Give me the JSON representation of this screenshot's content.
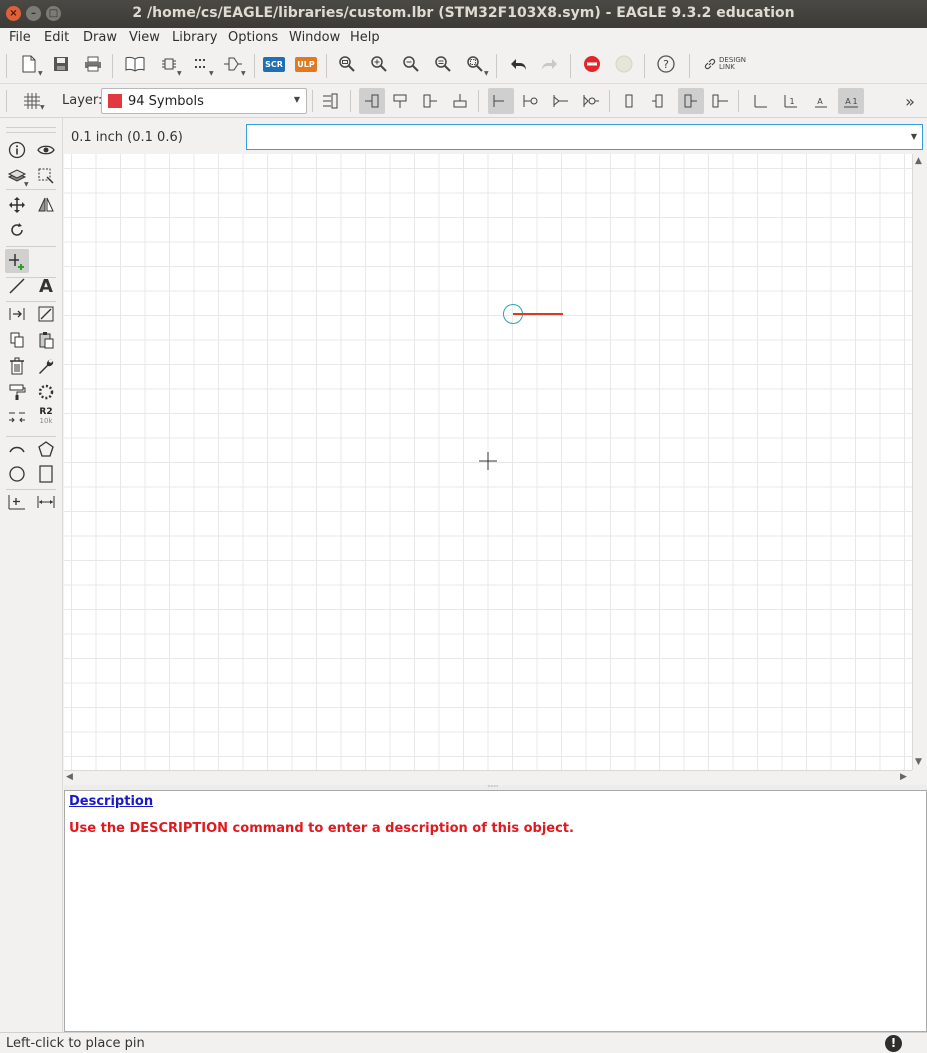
{
  "window": {
    "title": "2 /home/cs/EAGLE/libraries/custom.lbr (STM32F103X8.sym) - EAGLE 9.3.2 education",
    "close_glyph": "×",
    "min_glyph": "–",
    "max_glyph": "□"
  },
  "menu": [
    "File",
    "Edit",
    "Draw",
    "View",
    "Library",
    "Options",
    "Window",
    "Help"
  ],
  "toolbar": {
    "scr_label": "SCR",
    "ulp_label": "ULP",
    "design_link_label": "DESIGN LINK",
    "overflow_glyph": "»"
  },
  "layer": {
    "label": "Layer:",
    "selected": "94 Symbols",
    "swatch_color": "#e2383f"
  },
  "coordinates": "0.1 inch (0.1 0.6)",
  "command_line": {
    "value": "",
    "placeholder": ""
  },
  "left_tools": {
    "r2_label": "R2",
    "r2_sub": "10k",
    "text_tool_glyph": "A"
  },
  "canvas": {
    "grid_color": "#e8e8e8",
    "pin_color": "#e0391e",
    "origin_color": "#2aa7a7"
  },
  "description": {
    "title": "Description",
    "message": "Use the DESCRIPTION command to enter a description of this object."
  },
  "status": {
    "text": "Left-click to place pin",
    "icon_glyph": "!"
  }
}
